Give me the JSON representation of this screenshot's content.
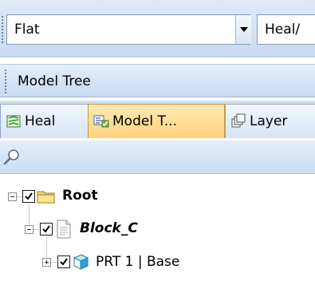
{
  "toolbar": {
    "display_mode": "Flat",
    "heal_mode": "Heal/"
  },
  "panel": {
    "title": "Model Tree"
  },
  "tabs": [
    {
      "label": "Heal",
      "icon": "heal-icon",
      "active": false
    },
    {
      "label": "Model T...",
      "icon": "model-tree-icon",
      "active": true
    },
    {
      "label": "Layer",
      "icon": "layers-icon",
      "active": false
    }
  ],
  "search": {
    "icon": "search-icon"
  },
  "tree": {
    "root": {
      "label": "Root",
      "checked": true,
      "icon": "folder-icon"
    },
    "block": {
      "label": "Block_C",
      "checked": true,
      "icon": "document-icon"
    },
    "part": {
      "label": "PRT 1 | Base",
      "checked": true,
      "icon": "cube-icon"
    }
  },
  "colors": {
    "active_tab": "#ffd27a",
    "toolbar_bg": "#c9dbf1",
    "cube": "#2aa3d8"
  }
}
